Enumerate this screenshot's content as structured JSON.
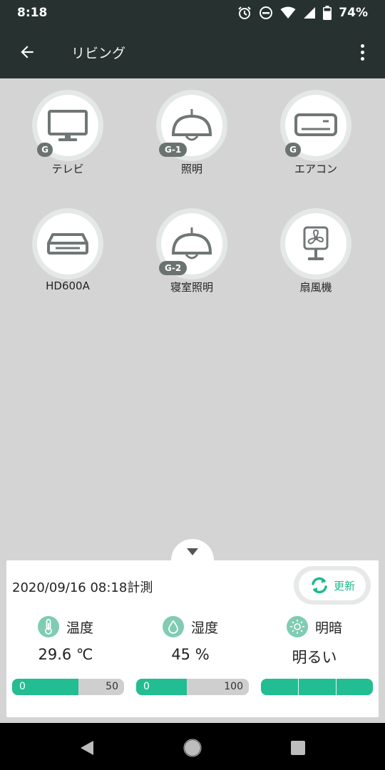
{
  "status_bar": {
    "time": "8:18",
    "battery": "74%",
    "icons": [
      "alarm-icon",
      "dnd-icon",
      "wifi-icon",
      "signal-icon",
      "battery-icon"
    ]
  },
  "app_bar": {
    "title": "リビング",
    "back_icon": "arrow-back-icon",
    "menu_icon": "more-vert-icon"
  },
  "devices": [
    {
      "label": "テレビ",
      "icon": "tv-icon",
      "badge": "G"
    },
    {
      "label": "照明",
      "icon": "ceiling-lamp-icon",
      "badge": "G-1"
    },
    {
      "label": "エアコン",
      "icon": "air-conditioner-icon",
      "badge": "G"
    },
    {
      "label": "HD600A",
      "icon": "recorder-icon",
      "badge": ""
    },
    {
      "label": "寝室照明",
      "icon": "ceiling-lamp-icon",
      "badge": "G-2"
    },
    {
      "label": "扇風機",
      "icon": "fan-icon",
      "badge": ""
    }
  ],
  "panel": {
    "measured_at": "2020/09/16 08:18計測",
    "refresh_label": "更新",
    "sensors": [
      {
        "name": "温度",
        "icon": "thermometer-icon",
        "value": "29.6 ℃",
        "bar_min": "0",
        "bar_max": "50",
        "level": 0.59
      },
      {
        "name": "湿度",
        "icon": "water-drop-icon",
        "value": "45 %",
        "bar_min": "0",
        "bar_max": "100",
        "level": 0.45
      },
      {
        "name": "明暗",
        "icon": "sun-icon",
        "value": "明るい",
        "level": 1.0,
        "segments": 3
      }
    ]
  },
  "colors": {
    "app_bar": "#263130",
    "accent": "#22bd92",
    "background": "#d4d4d4",
    "badge": "#6b7371"
  }
}
